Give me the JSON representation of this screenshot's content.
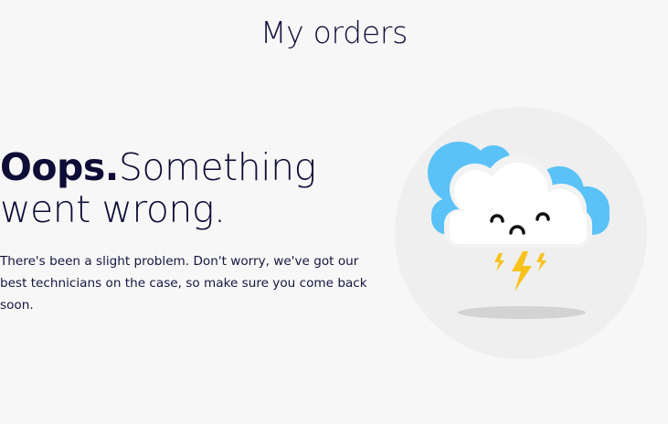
{
  "header": {
    "title": "My orders"
  },
  "error": {
    "heading_strong": "Oops.",
    "heading_rest": "Something went wrong.",
    "message": "There's been a slight problem. Don't worry, we've got our best technicians on the case, so make sure you come back soon."
  },
  "illustration": {
    "icon": "sad-storm-cloud-icon",
    "colors": {
      "circle": "#efefef",
      "cloud_back": "#5bc2f7",
      "cloud_front": "#ffffff",
      "lightning": "#f7c21b",
      "shadow": "#d3d3d3",
      "face": "#111111"
    }
  }
}
